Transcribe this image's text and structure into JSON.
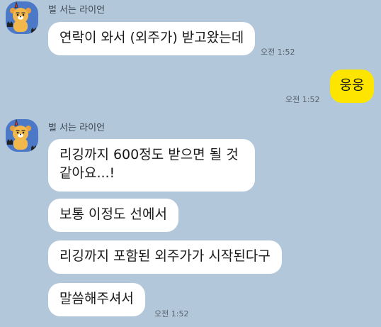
{
  "colors": {
    "background": "#b2c7d9",
    "incoming_bubble": "#ffffff",
    "outgoing_bubble": "#fee500",
    "avatar_background": "#4b78c7"
  },
  "messages": [
    {
      "sender": "벌 서는 라이언",
      "avatar_icon": "ryan-lion-avatar-icon",
      "text": "연락이 와서 (외주가) 받고왔는데",
      "time": "오전 1:52"
    },
    {
      "sender": "me",
      "text": "웅웅",
      "time": "오전 1:52"
    },
    {
      "sender": "벌 서는 라이언",
      "avatar_icon": "ryan-lion-avatar-icon",
      "texts": [
        "리깅까지 600정도 받으면 될 것 같아요...!",
        "보통 이정도 선에서",
        "리깅까지 포함된 외주가가 시작된다구",
        "말씀해주셔서"
      ],
      "time": "오전 1:52"
    }
  ]
}
